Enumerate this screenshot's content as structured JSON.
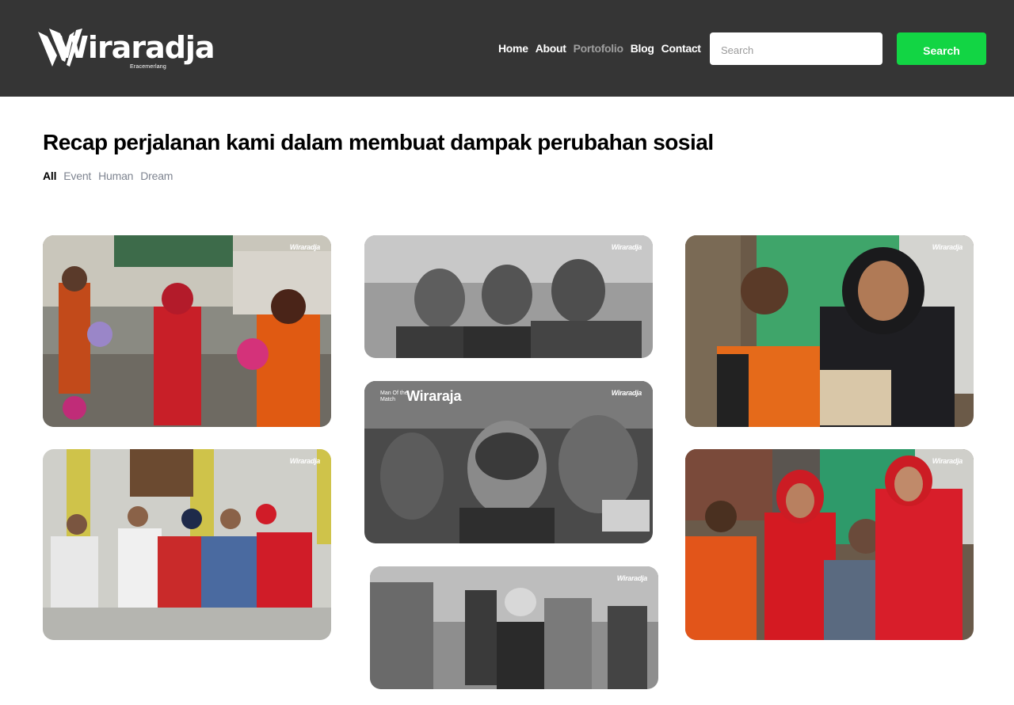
{
  "brand": {
    "name": "Wiraradja",
    "tagline": "Eracemerlang"
  },
  "nav": {
    "items": [
      {
        "label": "Home",
        "active": false
      },
      {
        "label": "About",
        "active": false
      },
      {
        "label": "Portofolio",
        "active": true
      },
      {
        "label": "Blog",
        "active": false
      },
      {
        "label": "Contact",
        "active": false
      }
    ]
  },
  "search": {
    "placeholder": "Search",
    "value": "",
    "button_label": "Search"
  },
  "main": {
    "title": "Recap perjalanan kami dalam membuat dampak perubahan sosial",
    "filters": [
      {
        "label": "All",
        "active": true
      },
      {
        "label": "Event",
        "active": false
      },
      {
        "label": "Human",
        "active": false
      },
      {
        "label": "Dream",
        "active": false
      }
    ]
  },
  "gallery": {
    "watermark": "Wiraradja",
    "motm_small": "Man Of the Match",
    "motm_brand": "Wiraraja",
    "photos": [
      {
        "subject": "women with balloons at street event",
        "style": "color"
      },
      {
        "subject": "three boys portrait",
        "style": "grayscale"
      },
      {
        "subject": "man and woman seated together",
        "style": "color"
      },
      {
        "subject": "five men seated on steps",
        "style": "color"
      },
      {
        "subject": "celebration crowd",
        "style": "grayscale"
      },
      {
        "subject": "family group seated",
        "style": "color"
      },
      {
        "subject": "child in street",
        "style": "grayscale"
      }
    ]
  },
  "colors": {
    "header_bg": "#353535",
    "accent_green": "#12d544",
    "nav_active": "#9e9e9e",
    "filter_inactive": "#7f8591"
  }
}
